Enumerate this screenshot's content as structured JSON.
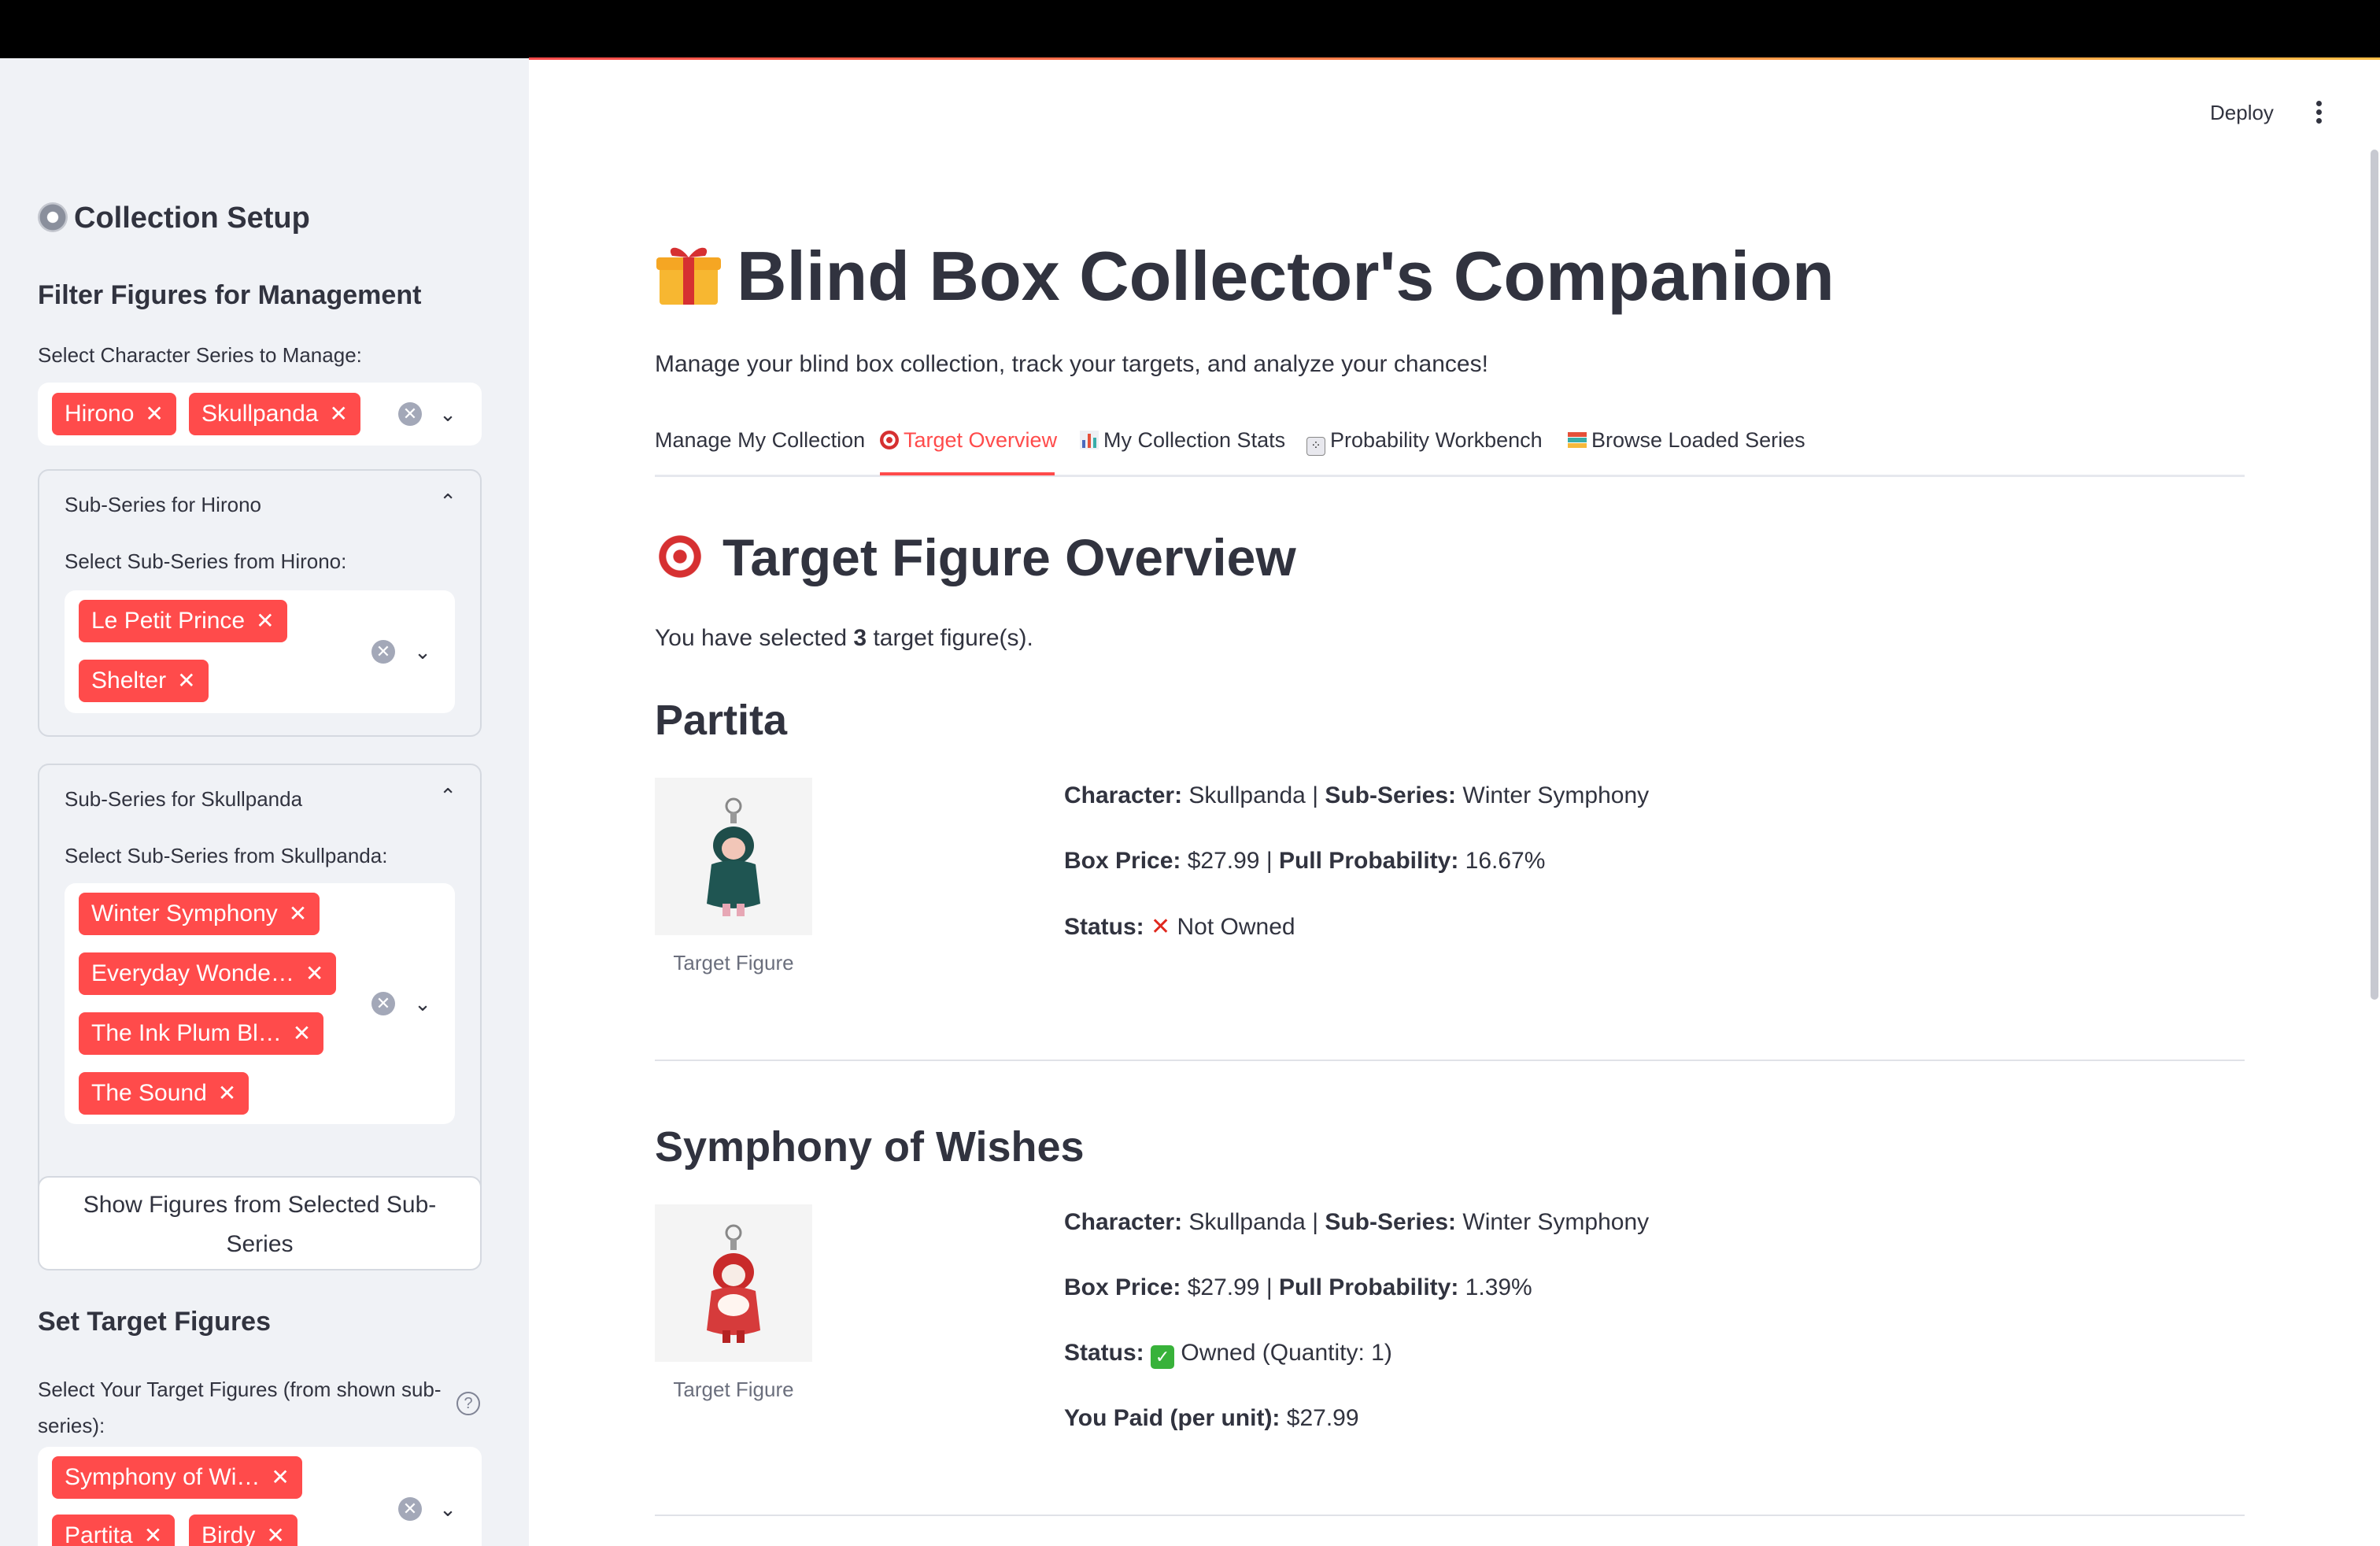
{
  "sidebar": {
    "setup_title": "Collection Setup",
    "filter_title": "Filter Figures for Management",
    "char_series_label": "Select Character Series to Manage:",
    "char_series_chips": [
      "Hirono",
      "Skullpanda"
    ],
    "expander_hirono": {
      "title": "Sub-Series for Hirono",
      "label": "Select Sub-Series from Hirono:",
      "chips": [
        "Le Petit Prince",
        "Shelter"
      ]
    },
    "expander_skullpanda": {
      "title": "Sub-Series for Skullpanda",
      "label": "Select Sub-Series from Skullpanda:",
      "chips": [
        "Winter Symphony",
        "Everyday Wonde…",
        "The Ink Plum Bl…",
        "The Sound"
      ]
    },
    "show_button": "Show Figures from Selected Sub-Series",
    "targets_title": "Set Target Figures",
    "targets_label": "Select Your Target Figures (from shown sub-series):",
    "target_chips": [
      "Symphony of Wi…",
      "Partita",
      "Birdy"
    ]
  },
  "header": {
    "deploy": "Deploy"
  },
  "main": {
    "title": "Blind Box Collector's Companion",
    "title_icon": "gift-icon",
    "subtitle": "Manage your blind box collection, track your targets, and analyze your chances!",
    "tabs": [
      {
        "label": "Manage My Collection",
        "icon": ""
      },
      {
        "label": "Target Overview",
        "icon": "target-icon"
      },
      {
        "label": "My Collection Stats",
        "icon": "bar-chart-icon"
      },
      {
        "label": "Probability Workbench",
        "icon": "dice-icon"
      },
      {
        "label": "Browse Loaded Series",
        "icon": "books-icon"
      }
    ],
    "section_title": "Target Figure Overview",
    "selected_prefix": "You have selected ",
    "selected_count": "3",
    "selected_suffix": " target figure(s).",
    "figures": [
      {
        "name": "Partita",
        "caption": "Target Figure",
        "character_label": "Character:",
        "character": "Skullpanda",
        "subseries_label": "Sub-Series:",
        "subseries": "Winter Symphony",
        "price_label": "Box Price:",
        "price": "$27.99",
        "prob_label": "Pull Probability:",
        "prob": "16.67%",
        "status_label": "Status:",
        "status_icon": "cross-icon",
        "status": "Not Owned"
      },
      {
        "name": "Symphony of Wishes",
        "caption": "Target Figure",
        "character_label": "Character:",
        "character": "Skullpanda",
        "subseries_label": "Sub-Series:",
        "subseries": "Winter Symphony",
        "price_label": "Box Price:",
        "price": "$27.99",
        "prob_label": "Pull Probability:",
        "prob": "1.39%",
        "status_label": "Status:",
        "status_icon": "check-icon",
        "status": "Owned (Quantity: 1)",
        "paid_label": "You Paid (per unit):",
        "paid": "$27.99"
      }
    ]
  },
  "colors": {
    "accent": "#ff4b4b",
    "sidebar_bg": "#f0f2f6",
    "text": "#31333f"
  }
}
